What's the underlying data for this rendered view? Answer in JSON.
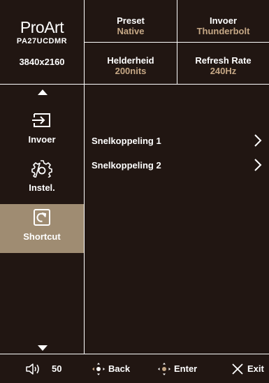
{
  "brand": {
    "logo": "ProArt",
    "model": "PA27UCDMR",
    "resolution": "3840x2160"
  },
  "info": {
    "preset": {
      "label": "Preset",
      "value": "Native"
    },
    "input": {
      "label": "Invoer",
      "value": "Thunderbolt"
    },
    "brightness": {
      "label": "Helderheid",
      "value": "200nits"
    },
    "refresh": {
      "label": "Refresh Rate",
      "value": "240Hz"
    }
  },
  "sidebar": {
    "items": [
      {
        "label": "Invoer",
        "icon": "input-icon"
      },
      {
        "label": "Instel.",
        "icon": "gear-icon"
      },
      {
        "label": "Shortcut",
        "icon": "shortcut-icon",
        "active": true
      }
    ]
  },
  "content": {
    "items": [
      {
        "label": "Snelkoppeling 1"
      },
      {
        "label": "Snelkoppeling 2"
      }
    ]
  },
  "footer": {
    "volume": "50",
    "back": "Back",
    "enter": "Enter",
    "exit": "Exit"
  },
  "colors": {
    "background": "#211612",
    "accent": "#c5a785",
    "active": "#9f8c72",
    "divider": "#ffffff"
  }
}
